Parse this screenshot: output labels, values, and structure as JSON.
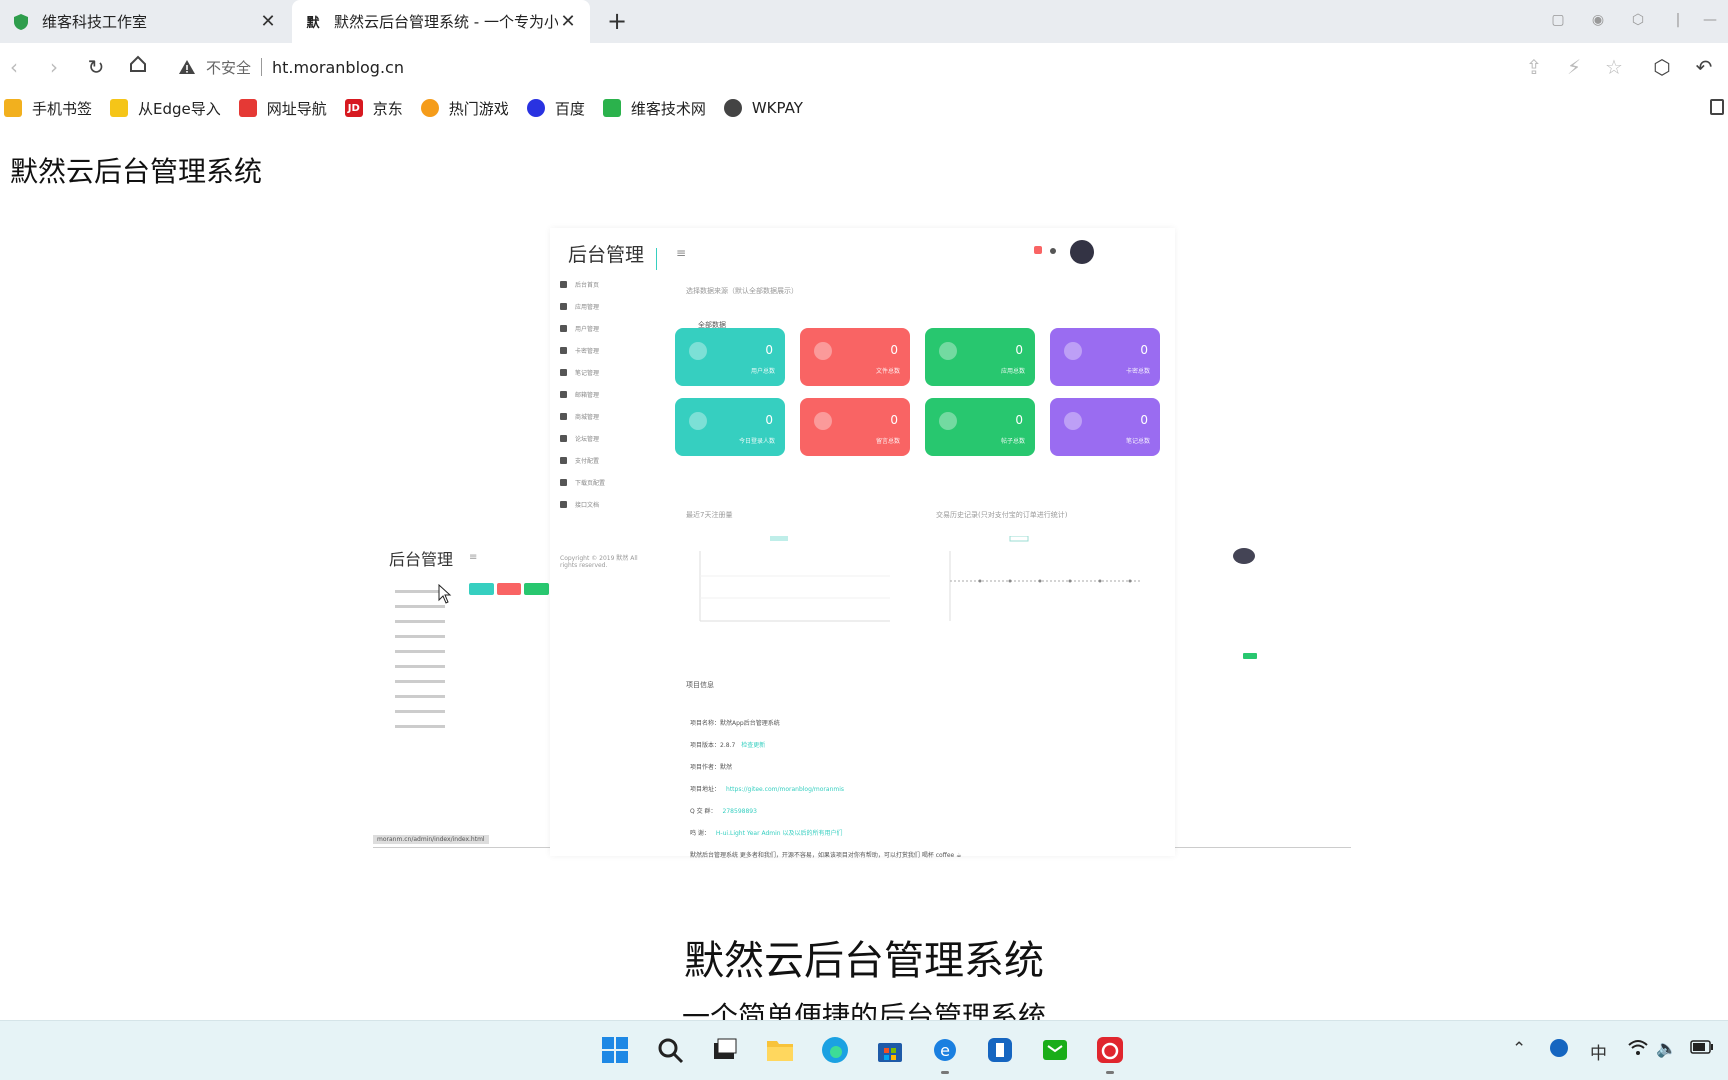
{
  "browser": {
    "tabs": [
      {
        "title": "维客科技工作室",
        "favicon": "shield-icon",
        "active": false
      },
      {
        "title": "默然云后台管理系统 - 一个专为小",
        "favicon": "site-favicon",
        "favicon_text": "默",
        "active": true
      }
    ],
    "address": {
      "security_label": "不安全",
      "url": "ht.moranblog.cn"
    }
  },
  "bookmarks": [
    {
      "label": "手机书签",
      "icon": "phone-icon",
      "color": "#f2b01e"
    },
    {
      "label": "从Edge导入",
      "icon": "folder-icon",
      "color": "#f5c518"
    },
    {
      "label": "网址导航",
      "icon": "nav-icon",
      "color": "#e53935"
    },
    {
      "label": "京东",
      "icon": "jd-icon",
      "color": "#d71920",
      "text": "JD"
    },
    {
      "label": "热门游戏",
      "icon": "game-icon",
      "color": "#f59c1a"
    },
    {
      "label": "百度",
      "icon": "baidu-icon",
      "color": "#2932e1"
    },
    {
      "label": "维客技术网",
      "icon": "leaf-icon",
      "color": "#2bb24c"
    },
    {
      "label": "WKPAY",
      "icon": "wkpay-icon",
      "color": "#444444"
    }
  ],
  "page": {
    "title": "默然云后台管理系统",
    "hero_title": "默然云后台管理系统",
    "hero_subtitle": "一个简单便捷的后台管理系统"
  },
  "preview": {
    "front": {
      "logo": "后台管理",
      "filter_label": "选择数据来源（默认全部数据展示）",
      "filter_value": "全部数据",
      "menu": [
        "后台首页",
        "应用管理",
        "用户管理",
        "卡密管理",
        "笔记管理",
        "邮箱管理",
        "商城管理",
        "论坛管理",
        "支付配置",
        "下载页配置",
        "接口文档"
      ],
      "cards": [
        {
          "value": "0",
          "label": "用户总数",
          "color": "#36cfc0"
        },
        {
          "value": "0",
          "label": "文件总数",
          "color": "#f96464"
        },
        {
          "value": "0",
          "label": "应用总数",
          "color": "#28c76f"
        },
        {
          "value": "0",
          "label": "卡密总数",
          "color": "#9a6cf1"
        },
        {
          "value": "0",
          "label": "今日登录人数",
          "color": "#36cfc0"
        },
        {
          "value": "0",
          "label": "留言总数",
          "color": "#f96464"
        },
        {
          "value": "0",
          "label": "帖子总数",
          "color": "#28c76f"
        },
        {
          "value": "0",
          "label": "笔记总数",
          "color": "#9a6cf1"
        }
      ],
      "chart1_title": "最近7天注册量",
      "chart2_title": "交易历史记录(只对支付宝的订单进行统计)",
      "copyright": "Copyright © 2019 默然 All rights reserved.",
      "project_title": "项目信息",
      "project_lines": [
        {
          "label": "项目名称：默然App后台管理系统",
          "link": ""
        },
        {
          "label": "项目版本：2.8.7",
          "link": "检查更新"
        },
        {
          "label": "项目作者：默然",
          "link": ""
        },
        {
          "label": "项目地址：",
          "link": "https://gitee.com/moranblog/moranmis"
        },
        {
          "label": "Q  交 群：",
          "link": "278598893"
        },
        {
          "label": "鸣    谢：",
          "link": "H-ui.Light Year Admin 以及以后的所有用户们"
        },
        {
          "label": "默然后台管理系统 更多者和我们，开源不容易，如果该项目对你有帮助，可以打赏我们 喝杯 coffee ☕",
          "link": ""
        }
      ]
    },
    "back": {
      "logo": "后台管理",
      "status_url": "moranm.cn/admin/index/index.html"
    }
  },
  "taskbar": {
    "apps": [
      "windows-start-icon",
      "search-icon",
      "task-view-icon",
      "file-explorer-icon",
      "edge-icon",
      "store-icon",
      "ie-icon",
      "todo-icon",
      "wechat-icon",
      "netease-music-icon"
    ],
    "ime": "中"
  }
}
